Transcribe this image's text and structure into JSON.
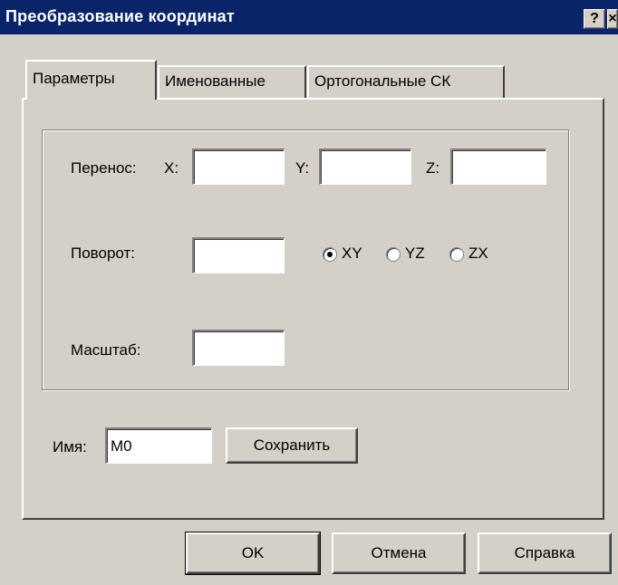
{
  "window": {
    "title": "Преобразование координат",
    "help_label": "?",
    "close_label": "×"
  },
  "tabs": [
    {
      "label": "Параметры",
      "active": true
    },
    {
      "label": "Именованные",
      "active": false
    },
    {
      "label": "Ортогональные СК",
      "active": false
    }
  ],
  "params": {
    "translate_label": "Перенос:",
    "x_label": "X:",
    "y_label": "Y:",
    "z_label": "Z:",
    "x_value": "",
    "y_value": "",
    "z_value": "",
    "rotate_label": "Поворот:",
    "rotate_value": "",
    "planes": [
      {
        "label": "XY",
        "selected": true
      },
      {
        "label": "YZ",
        "selected": false
      },
      {
        "label": "ZX",
        "selected": false
      }
    ],
    "scale_label": "Масштаб:",
    "scale_value": ""
  },
  "name": {
    "label": "Имя:",
    "value": "M0",
    "save_label": "Сохранить"
  },
  "buttons": {
    "ok": "OK",
    "cancel": "Отмена",
    "help": "Справка"
  }
}
